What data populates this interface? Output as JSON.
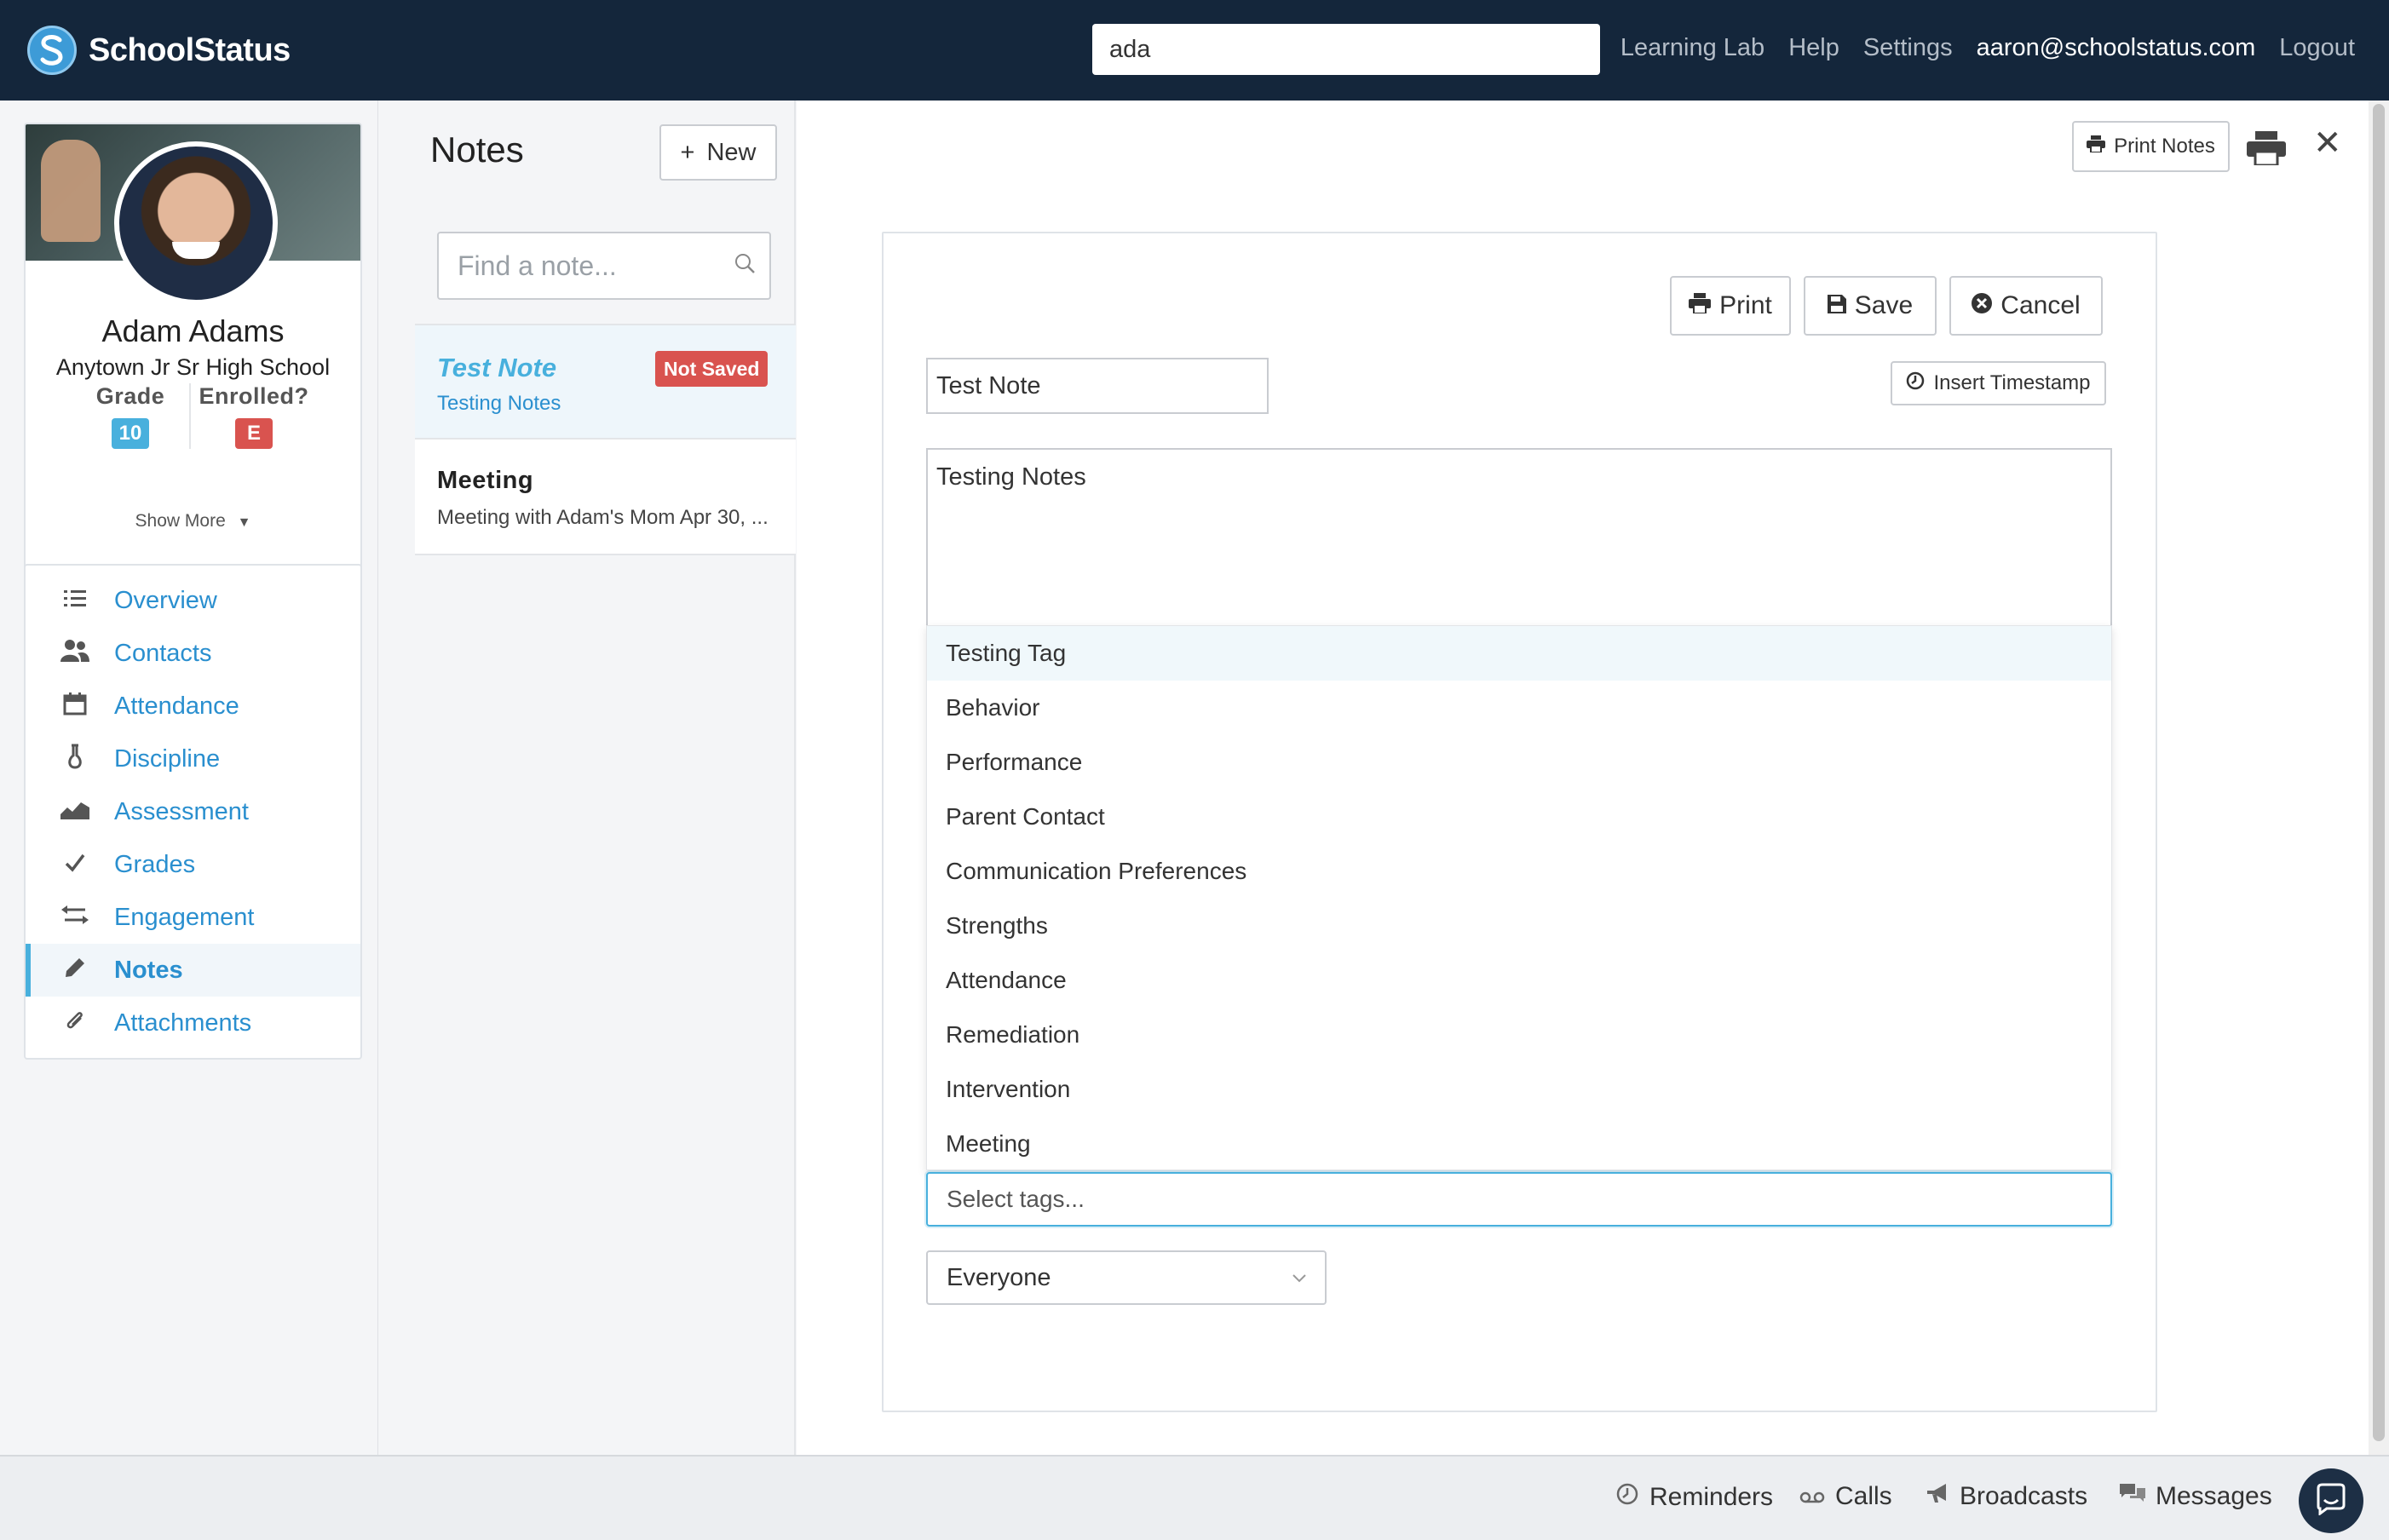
{
  "app": {
    "brand_name": "SchoolStatus",
    "search_value": "ada",
    "nav": {
      "learning_lab": "Learning Lab",
      "help": "Help",
      "settings": "Settings",
      "user_email": "aaron@schoolstatus.com",
      "logout": "Logout"
    }
  },
  "student": {
    "name": "Adam Adams",
    "school": "Anytown Jr Sr High School",
    "grade_label": "Grade",
    "grade_value": "10",
    "enrolled_label": "Enrolled?",
    "enrolled_value": "E",
    "show_more": "Show More"
  },
  "sidebar": {
    "items": [
      {
        "label": "Overview",
        "icon": "list-icon"
      },
      {
        "label": "Contacts",
        "icon": "people-icon"
      },
      {
        "label": "Attendance",
        "icon": "calendar-icon"
      },
      {
        "label": "Discipline",
        "icon": "flask-icon"
      },
      {
        "label": "Assessment",
        "icon": "area-chart-icon"
      },
      {
        "label": "Grades",
        "icon": "check-icon"
      },
      {
        "label": "Engagement",
        "icon": "exchange-icon"
      },
      {
        "label": "Notes",
        "icon": "pencil-icon",
        "active": true
      },
      {
        "label": "Attachments",
        "icon": "paperclip-icon"
      }
    ]
  },
  "notes": {
    "title": "Notes",
    "new_button": "New",
    "search_placeholder": "Find a note...",
    "items": [
      {
        "title": "Test Note",
        "subtitle": "Testing Notes",
        "badge": "Not Saved"
      },
      {
        "title": "Meeting",
        "subtitle": "Meeting with Adam's Mom Apr 30, ..."
      }
    ]
  },
  "main": {
    "print_notes_button": "Print Notes",
    "editor": {
      "print_button": "Print",
      "save_button": "Save",
      "cancel_button": "Cancel",
      "title_value": "Test Note",
      "insert_timestamp_button": "Insert Timestamp",
      "body_value": "Testing Notes",
      "tag_options": [
        "Testing Tag",
        "Behavior",
        "Performance",
        "Parent Contact",
        "Communication Preferences",
        "Strengths",
        "Attendance",
        "Remediation",
        "Intervention",
        "Meeting"
      ],
      "tags_placeholder": "Select tags...",
      "visibility_value": "Everyone"
    }
  },
  "bottombar": {
    "reminders": "Reminders",
    "calls": "Calls",
    "broadcasts": "Broadcasts",
    "messages": "Messages"
  },
  "colors": {
    "topbar": "#14263b",
    "accent": "#48b0dd",
    "link": "#2a8fcf",
    "danger": "#d9534f"
  }
}
